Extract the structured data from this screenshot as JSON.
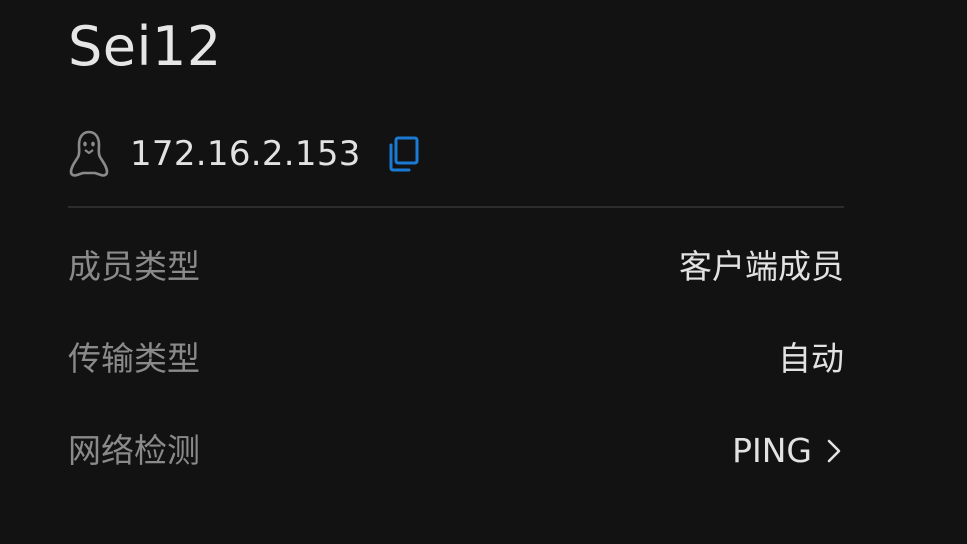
{
  "device": {
    "name": "Sei12",
    "os_icon": "linux-penguin-icon",
    "ip": "172.16.2.153",
    "copy_icon": "copy-icon"
  },
  "details": [
    {
      "label": "成员类型",
      "value": "客户端成员"
    },
    {
      "label": "传输类型",
      "value": "自动"
    },
    {
      "label": "网络检测",
      "value": "PING"
    }
  ],
  "colors": {
    "background": "#121212",
    "accent": "#1a7ad4",
    "primary_text": "#e2e2e2",
    "secondary_text": "#8a8a8a"
  }
}
